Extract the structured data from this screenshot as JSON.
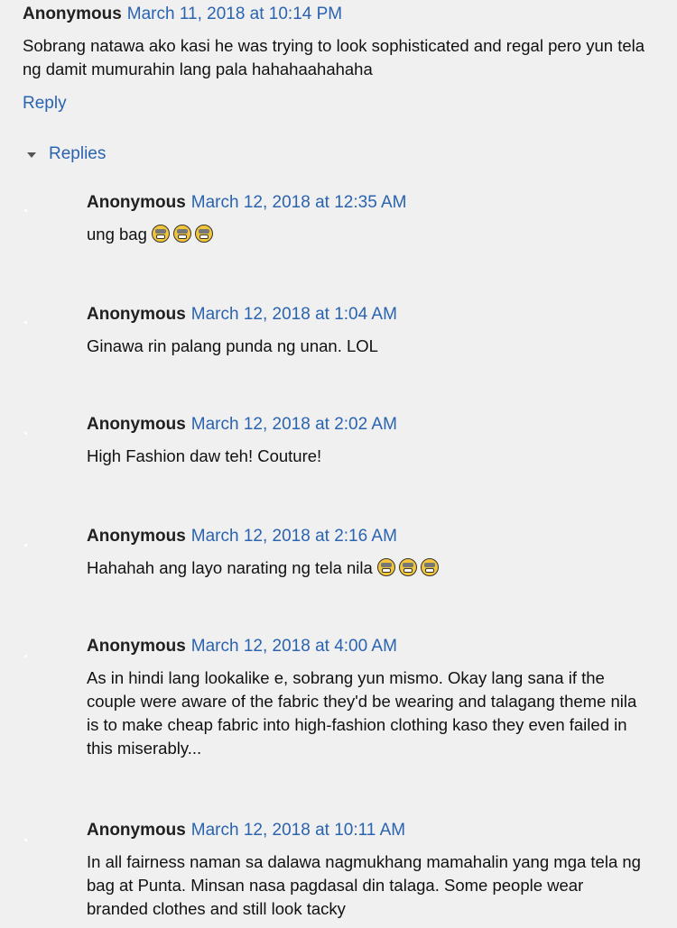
{
  "top_comment": {
    "author": "Anonymous",
    "timestamp": "March 11, 2018 at 10:14 PM",
    "text": "Sobrang natawa ako kasi he was trying to look sophisticated and regal pero yun tela ng damit mumurahin lang pala hahahaahahaha",
    "reply_label": "Reply"
  },
  "replies_toggle": {
    "label": "Replies"
  },
  "replies": [
    {
      "author": "Anonymous",
      "timestamp": "March 12, 2018 at 12:35 AM",
      "text": "ung bag",
      "emoji_icon": "grinning-sweat-emoji",
      "emoji_count": 3
    },
    {
      "author": "Anonymous",
      "timestamp": "March 12, 2018 at 1:04 AM",
      "text": "Ginawa rin palang punda ng unan. LOL"
    },
    {
      "author": "Anonymous",
      "timestamp": "March 12, 2018 at 2:02 AM",
      "text": "High Fashion daw teh! Couture!"
    },
    {
      "author": "Anonymous",
      "timestamp": "March 12, 2018 at 2:16 AM",
      "text": "Hahahah ang layo narating ng tela nila",
      "emoji_icon": "grinning-sweat-emoji",
      "emoji_count": 3
    },
    {
      "author": "Anonymous",
      "timestamp": "March 12, 2018 at 4:00 AM",
      "text": "As in hindi lang lookalike e, sobrang yun mismo. Okay lang sana if the couple were aware of the fabric they'd be wearing and talagang theme nila is to make cheap fabric into high-fashion clothing kaso they even failed in this miserably..."
    },
    {
      "author": "Anonymous",
      "timestamp": "March 12, 2018 at 10:11 AM",
      "text": "In all fairness naman sa dalawa nagmukhang mamahalin yang mga tela ng bag at Punta. Minsan nasa pagdasal din talaga. Some people wear branded clothes and still look tacky"
    }
  ],
  "colors": {
    "link": "#2a63b0",
    "background": "#f0f0f0",
    "text": "#111111"
  }
}
